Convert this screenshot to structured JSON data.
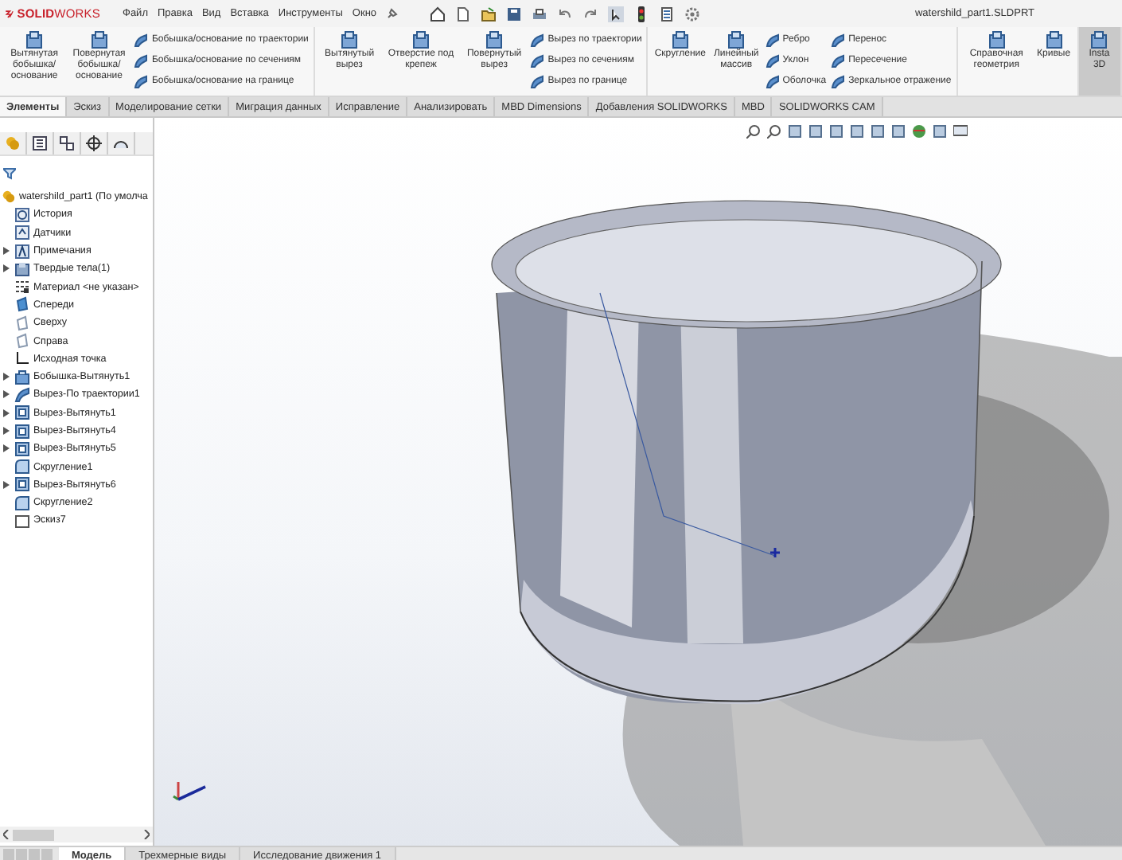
{
  "app": {
    "logo_text": "**SOLID**WORKS",
    "title": "watershild_part1.SLDPRT"
  },
  "menu": [
    "Файл",
    "Правка",
    "Вид",
    "Вставка",
    "Инструменты",
    "Окно"
  ],
  "ribbon_groups": [
    {
      "large": [
        "Вытянутая бобышка/основание",
        "Повернутая бобышка/основание"
      ],
      "columns": [
        [
          "Бобышка/основание по траектории",
          "Бобышка/основание по сечениям",
          "Бобышка/основание на границе"
        ]
      ],
      "highlighted": false
    },
    {
      "large": [
        "Вытянутый вырез",
        "Отверстие под крепеж",
        "Повернутый вырез"
      ],
      "columns": [
        [
          "Вырез по траектории",
          "Вырез по сечениям",
          "Вырез по границе"
        ]
      ],
      "highlighted": false
    },
    {
      "large": [
        "Скругление",
        "Линейный массив"
      ],
      "columns": [
        [
          "Ребро",
          "Уклон",
          "Оболочка"
        ],
        [
          "Перенос",
          "Пересечение",
          "Зеркальное отражение"
        ]
      ],
      "highlighted": false
    },
    {
      "large": [
        "Справочная геометрия",
        "Кривые"
      ],
      "highlighted": false
    },
    {
      "large": [
        "Insta 3D"
      ],
      "highlighted": true
    }
  ],
  "command_tabs": [
    {
      "label": "Элементы",
      "selected": true
    },
    {
      "label": "Эскиз",
      "selected": false
    },
    {
      "label": "Моделирование сетки",
      "selected": false
    },
    {
      "label": "Миграция данных",
      "selected": false
    },
    {
      "label": "Исправление",
      "selected": false
    },
    {
      "label": "Анализировать",
      "selected": false
    },
    {
      "label": "MBD Dimensions",
      "selected": false
    },
    {
      "label": "Добавления SOLIDWORKS",
      "selected": false
    },
    {
      "label": "MBD",
      "selected": false
    },
    {
      "label": "SOLIDWORKS CAM",
      "selected": false
    }
  ],
  "tree": {
    "root": "watershild_part1 (По умолча",
    "items": [
      {
        "label": "История",
        "kind": "history",
        "expandable": false
      },
      {
        "label": "Датчики",
        "kind": "sensor",
        "expandable": false
      },
      {
        "label": "Примечания",
        "kind": "annotation",
        "expandable": true
      },
      {
        "label": "Твердые тела(1)",
        "kind": "body",
        "expandable": true
      },
      {
        "label": "Материал <не указан>",
        "kind": "material",
        "expandable": false
      },
      {
        "label": "Спереди",
        "kind": "plane_selected",
        "expandable": false
      },
      {
        "label": "Сверху",
        "kind": "plane",
        "expandable": false
      },
      {
        "label": "Справа",
        "kind": "plane",
        "expandable": false
      },
      {
        "label": "Исходная точка",
        "kind": "origin",
        "expandable": false
      },
      {
        "label": "Бобышка-Вытянуть1",
        "kind": "boss",
        "expandable": true
      },
      {
        "label": "Вырез-По траектории1",
        "kind": "sweep",
        "expandable": true
      },
      {
        "label": "Вырез-Вытянуть1",
        "kind": "cut",
        "expandable": true
      },
      {
        "label": "Вырез-Вытянуть4",
        "kind": "cut",
        "expandable": true
      },
      {
        "label": "Вырез-Вытянуть5",
        "kind": "cut",
        "expandable": true
      },
      {
        "label": "Скругление1",
        "kind": "fillet",
        "expandable": false
      },
      {
        "label": "Вырез-Вытянуть6",
        "kind": "cut",
        "expandable": true
      },
      {
        "label": "Скругление2",
        "kind": "fillet",
        "expandable": false
      },
      {
        "label": "Эскиз7",
        "kind": "sketch",
        "expandable": false
      }
    ]
  },
  "bottom_tabs": [
    {
      "label": "Модель",
      "selected": true
    },
    {
      "label": "Трехмерные виды",
      "selected": false
    },
    {
      "label": "Исследование движения 1",
      "selected": false
    }
  ]
}
